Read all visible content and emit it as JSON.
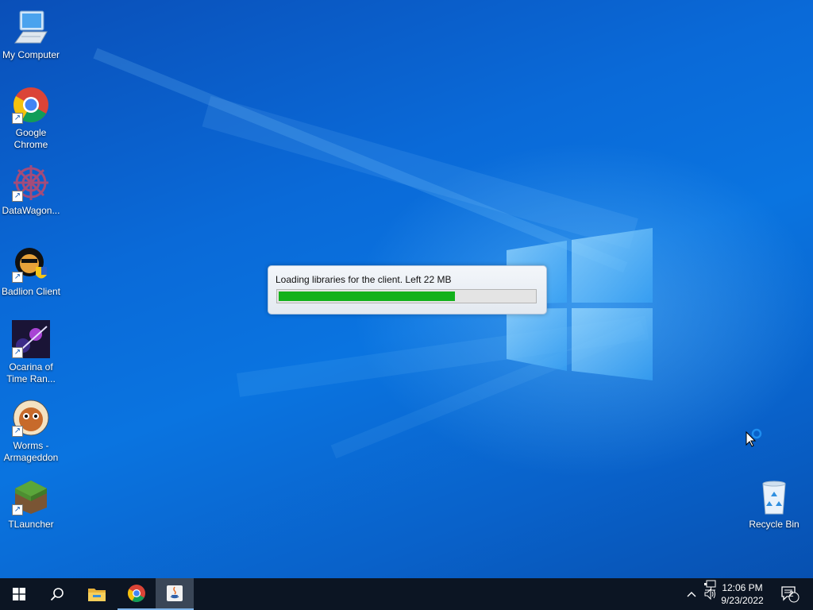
{
  "desktop": {
    "icons": [
      {
        "label": "My Computer",
        "icon": "computer-icon"
      },
      {
        "label": "Google Chrome",
        "icon": "chrome-icon"
      },
      {
        "label": "DataWagon...",
        "icon": "datawagon-icon"
      },
      {
        "label": "Badlion Client",
        "icon": "badlion-icon"
      },
      {
        "label": "Ocarina of Time Ran...",
        "icon": "ocarina-icon"
      },
      {
        "label": "Worms - Armageddon",
        "icon": "worms-icon"
      },
      {
        "label": "TLauncher",
        "icon": "tlauncher-icon"
      },
      {
        "label": "Recycle Bin",
        "icon": "recycle-bin-icon"
      }
    ]
  },
  "loader": {
    "message": "Loading libraries for the client. Left 22 MB",
    "progress": 0.69,
    "color": "#12b11b"
  },
  "taskbar": {
    "buttons": [
      "start-icon",
      "search-icon",
      "file-explorer-icon",
      "chrome-icon",
      "java-icon"
    ],
    "active": "java-icon",
    "tray_icons": [
      "chevron-up-icon",
      "network-icon",
      "volume-icon"
    ],
    "clock": {
      "time": "12:06 PM",
      "date": "9/23/2022"
    },
    "notifications": {
      "count": "2"
    }
  }
}
